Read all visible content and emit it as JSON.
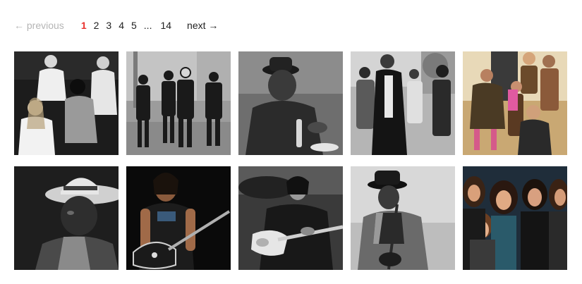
{
  "pagination": {
    "previous_label": "← previous",
    "pages": [
      "1",
      "2",
      "3",
      "4",
      "5"
    ],
    "current_page": "1",
    "ellipsis": "...",
    "last_page": "14",
    "next_label": "next →",
    "current_color": "#e8322e"
  },
  "gallery": {
    "thumbnails": [
      {
        "subject": "band-portrait-group-of-four"
      },
      {
        "subject": "four-musicians-standing-in-street"
      },
      {
        "subject": "man-in-hat-seated-at-table"
      },
      {
        "subject": "group-of-young-men-outdoors"
      },
      {
        "subject": "band-posing-in-color"
      },
      {
        "subject": "man-in-straw-hat-closeup"
      },
      {
        "subject": "guitarist-in-tank-top"
      },
      {
        "subject": "guitarist-playing-electric-guitar"
      },
      {
        "subject": "man-in-hat-with-guitar"
      },
      {
        "subject": "rock-band-group-portrait-color"
      }
    ]
  }
}
